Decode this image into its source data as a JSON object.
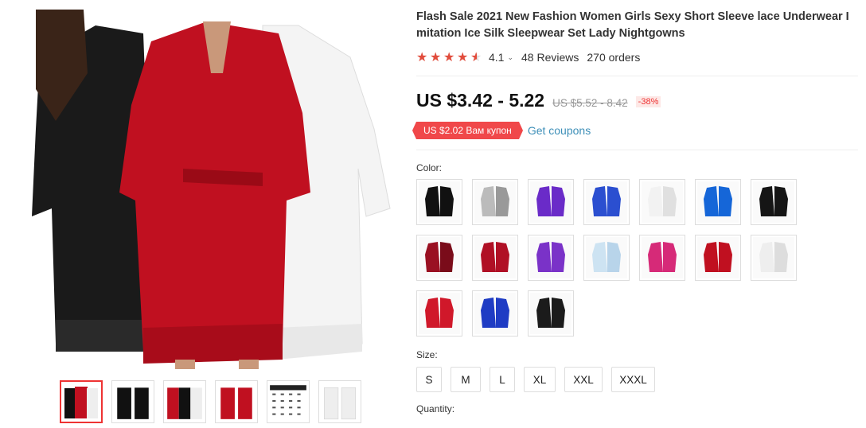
{
  "product": {
    "title": "Flash Sale 2021 New Fashion Women Girls Sexy Short Sleeve lace Underwear Imitation Ice Silk Sleepwear Set Lady Nightgowns",
    "rating": "4.1",
    "rating_value": 4.1,
    "reviews": "48 Reviews",
    "orders": "270 orders"
  },
  "price": {
    "current": "US $3.42 - 5.22",
    "original": "US $5.52 - 8.42",
    "discount": "-38%"
  },
  "coupon": {
    "label": "US $2.02 Вам купон",
    "link": "Get coupons"
  },
  "color": {
    "label": "Color:",
    "options": [
      "black",
      "gray",
      "purple",
      "blue",
      "white",
      "royal-blue",
      "black-2",
      "wine-red",
      "red",
      "violet",
      "light-blue",
      "pink",
      "red-2",
      "white-2",
      "red-3",
      "navy",
      "black-3"
    ]
  },
  "size": {
    "label": "Size:",
    "options": [
      "S",
      "M",
      "L",
      "XL",
      "XXL",
      "XXXL"
    ]
  },
  "quantity": {
    "label": "Quantity:"
  },
  "gallery": {
    "thumbnails": [
      "black-red-white",
      "black-black",
      "red-white",
      "red-red",
      "size-chart",
      "white-white"
    ],
    "active_index": 0
  },
  "colors": {
    "accent": "#e33333",
    "star": "#e14c3c",
    "link": "#3d8fb8",
    "coupon_bg": "#f0484a"
  }
}
